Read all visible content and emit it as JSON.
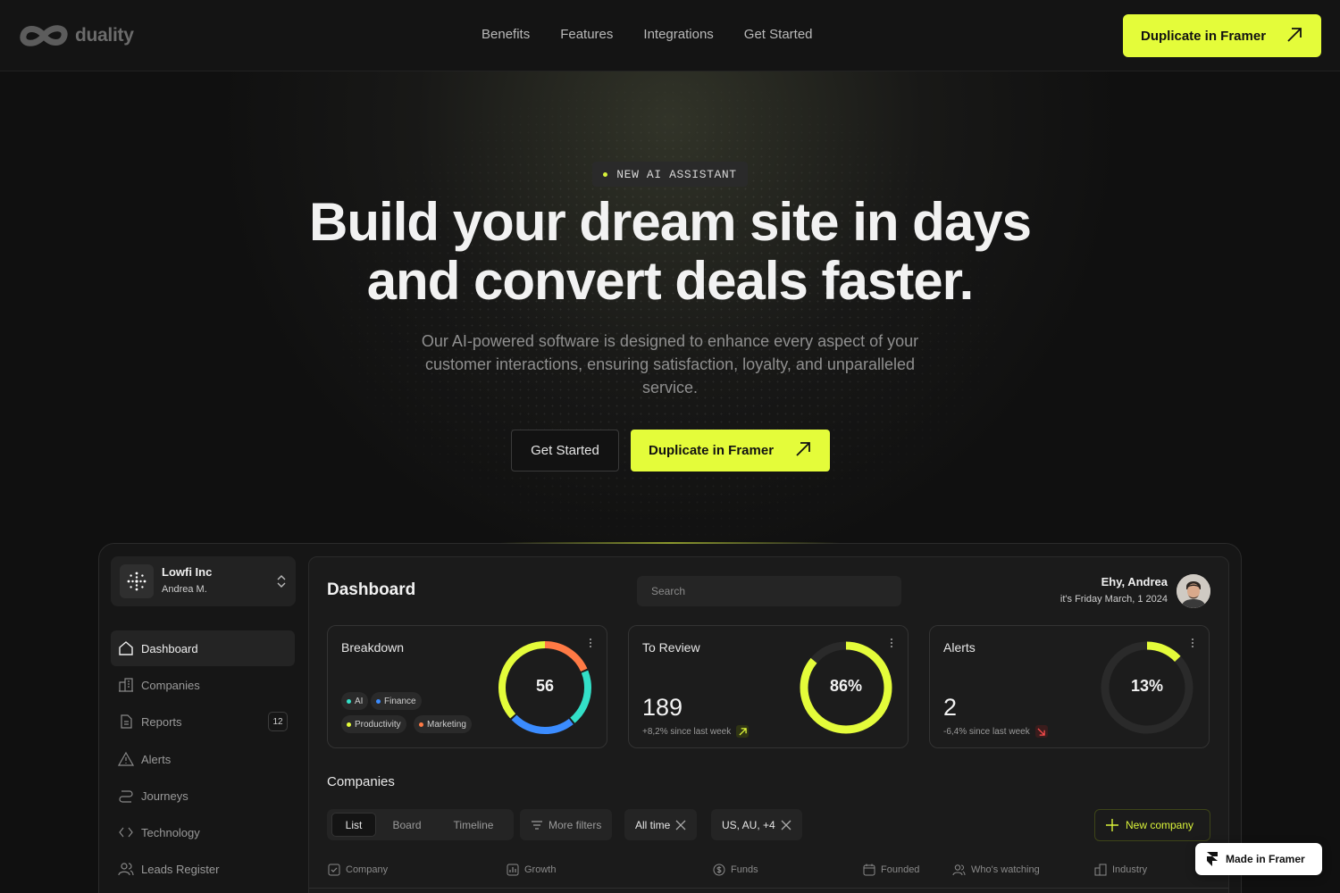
{
  "brand": {
    "name": "duality"
  },
  "nav": {
    "links": [
      "Benefits",
      "Features",
      "Integrations",
      "Get Started"
    ],
    "cta": "Duplicate in Framer"
  },
  "hero": {
    "badge": "NEW AI ASSISTANT",
    "headline_line1": "Build your dream site in days",
    "headline_line2": "and convert deals faster.",
    "subtext": "Our AI-powered software is designed to enhance every aspect of your customer interactions, ensuring satisfaction, loyalty, and unparalleled service.",
    "btn_secondary": "Get Started",
    "btn_primary": "Duplicate in Framer"
  },
  "accent_color": "#e4fc3a",
  "sidebar": {
    "org_name": "Lowfi Inc",
    "org_user": "Andrea M.",
    "items": [
      {
        "label": "Dashboard",
        "icon": "home-icon"
      },
      {
        "label": "Companies",
        "icon": "building-icon"
      },
      {
        "label": "Reports",
        "icon": "document-icon",
        "count": "12"
      },
      {
        "label": "Alerts",
        "icon": "warning-icon"
      },
      {
        "label": "Journeys",
        "icon": "route-icon"
      },
      {
        "label": "Technology",
        "icon": "code-icon"
      },
      {
        "label": "Leads Register",
        "icon": "users-icon"
      }
    ]
  },
  "dashboard": {
    "title": "Dashboard",
    "search_placeholder": "Search",
    "greeting": "Ehy, Andrea",
    "date": "it's Friday March, 1 2024",
    "breakdown": {
      "title": "Breakdown",
      "value": "56",
      "chips": [
        {
          "label": "AI",
          "color": "#33e0c8"
        },
        {
          "label": "Finance",
          "color": "#3b8cff"
        },
        {
          "label": "Productivity",
          "color": "#e4fc3a"
        },
        {
          "label": "Marketing",
          "color": "#ff7a45"
        }
      ]
    },
    "to_review": {
      "title": "To Review",
      "percent_label": "86%",
      "percent": 86,
      "count": "189",
      "delta": "+8,2% since last week"
    },
    "alerts": {
      "title": "Alerts",
      "percent_label": "13%",
      "percent": 13,
      "count": "2",
      "delta": "-6,4% since last week"
    },
    "companies": {
      "title": "Companies",
      "tabs": [
        "List",
        "Board",
        "Timeline"
      ],
      "more_filters": "More filters",
      "filter_time": "All time",
      "filter_region": "US, AU, +4",
      "new_company": "New company",
      "columns": [
        "Company",
        "Growth",
        "Funds",
        "Founded",
        "Who's watching",
        "Industry"
      ]
    }
  },
  "made_in": "Made in Framer"
}
